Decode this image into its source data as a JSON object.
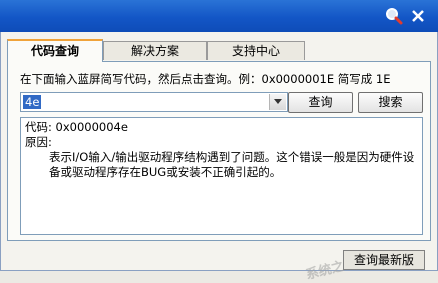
{
  "window": {
    "title_icons": [
      "search-icon",
      "close-icon"
    ],
    "titlebar_color": "#1a5fd0"
  },
  "tabs": [
    {
      "label": "代码查询",
      "active": true
    },
    {
      "label": "解决方案",
      "active": false
    },
    {
      "label": "支持中心",
      "active": false
    }
  ],
  "query": {
    "instruction": "在下面输入蓝屏简写代码，然后点击查询。例：0x0000001E 简写成 1E",
    "code_value": "4e",
    "query_button": "查询",
    "search_button": "搜索"
  },
  "result": {
    "code_line": "代码: 0x0000004e",
    "reason_label": "原因:",
    "description": "表示I/O输入/输出驱动程序结构遇到了问题。这个错误一般是因为硬件设备或驱动程序存在BUG或安装不正确引起的。"
  },
  "footer": {
    "update_button": "查询最新版"
  },
  "watermark": {
    "text": "系统之家"
  },
  "colors": {
    "accent_tab": "#f0a33a",
    "selection": "#316ac5"
  }
}
